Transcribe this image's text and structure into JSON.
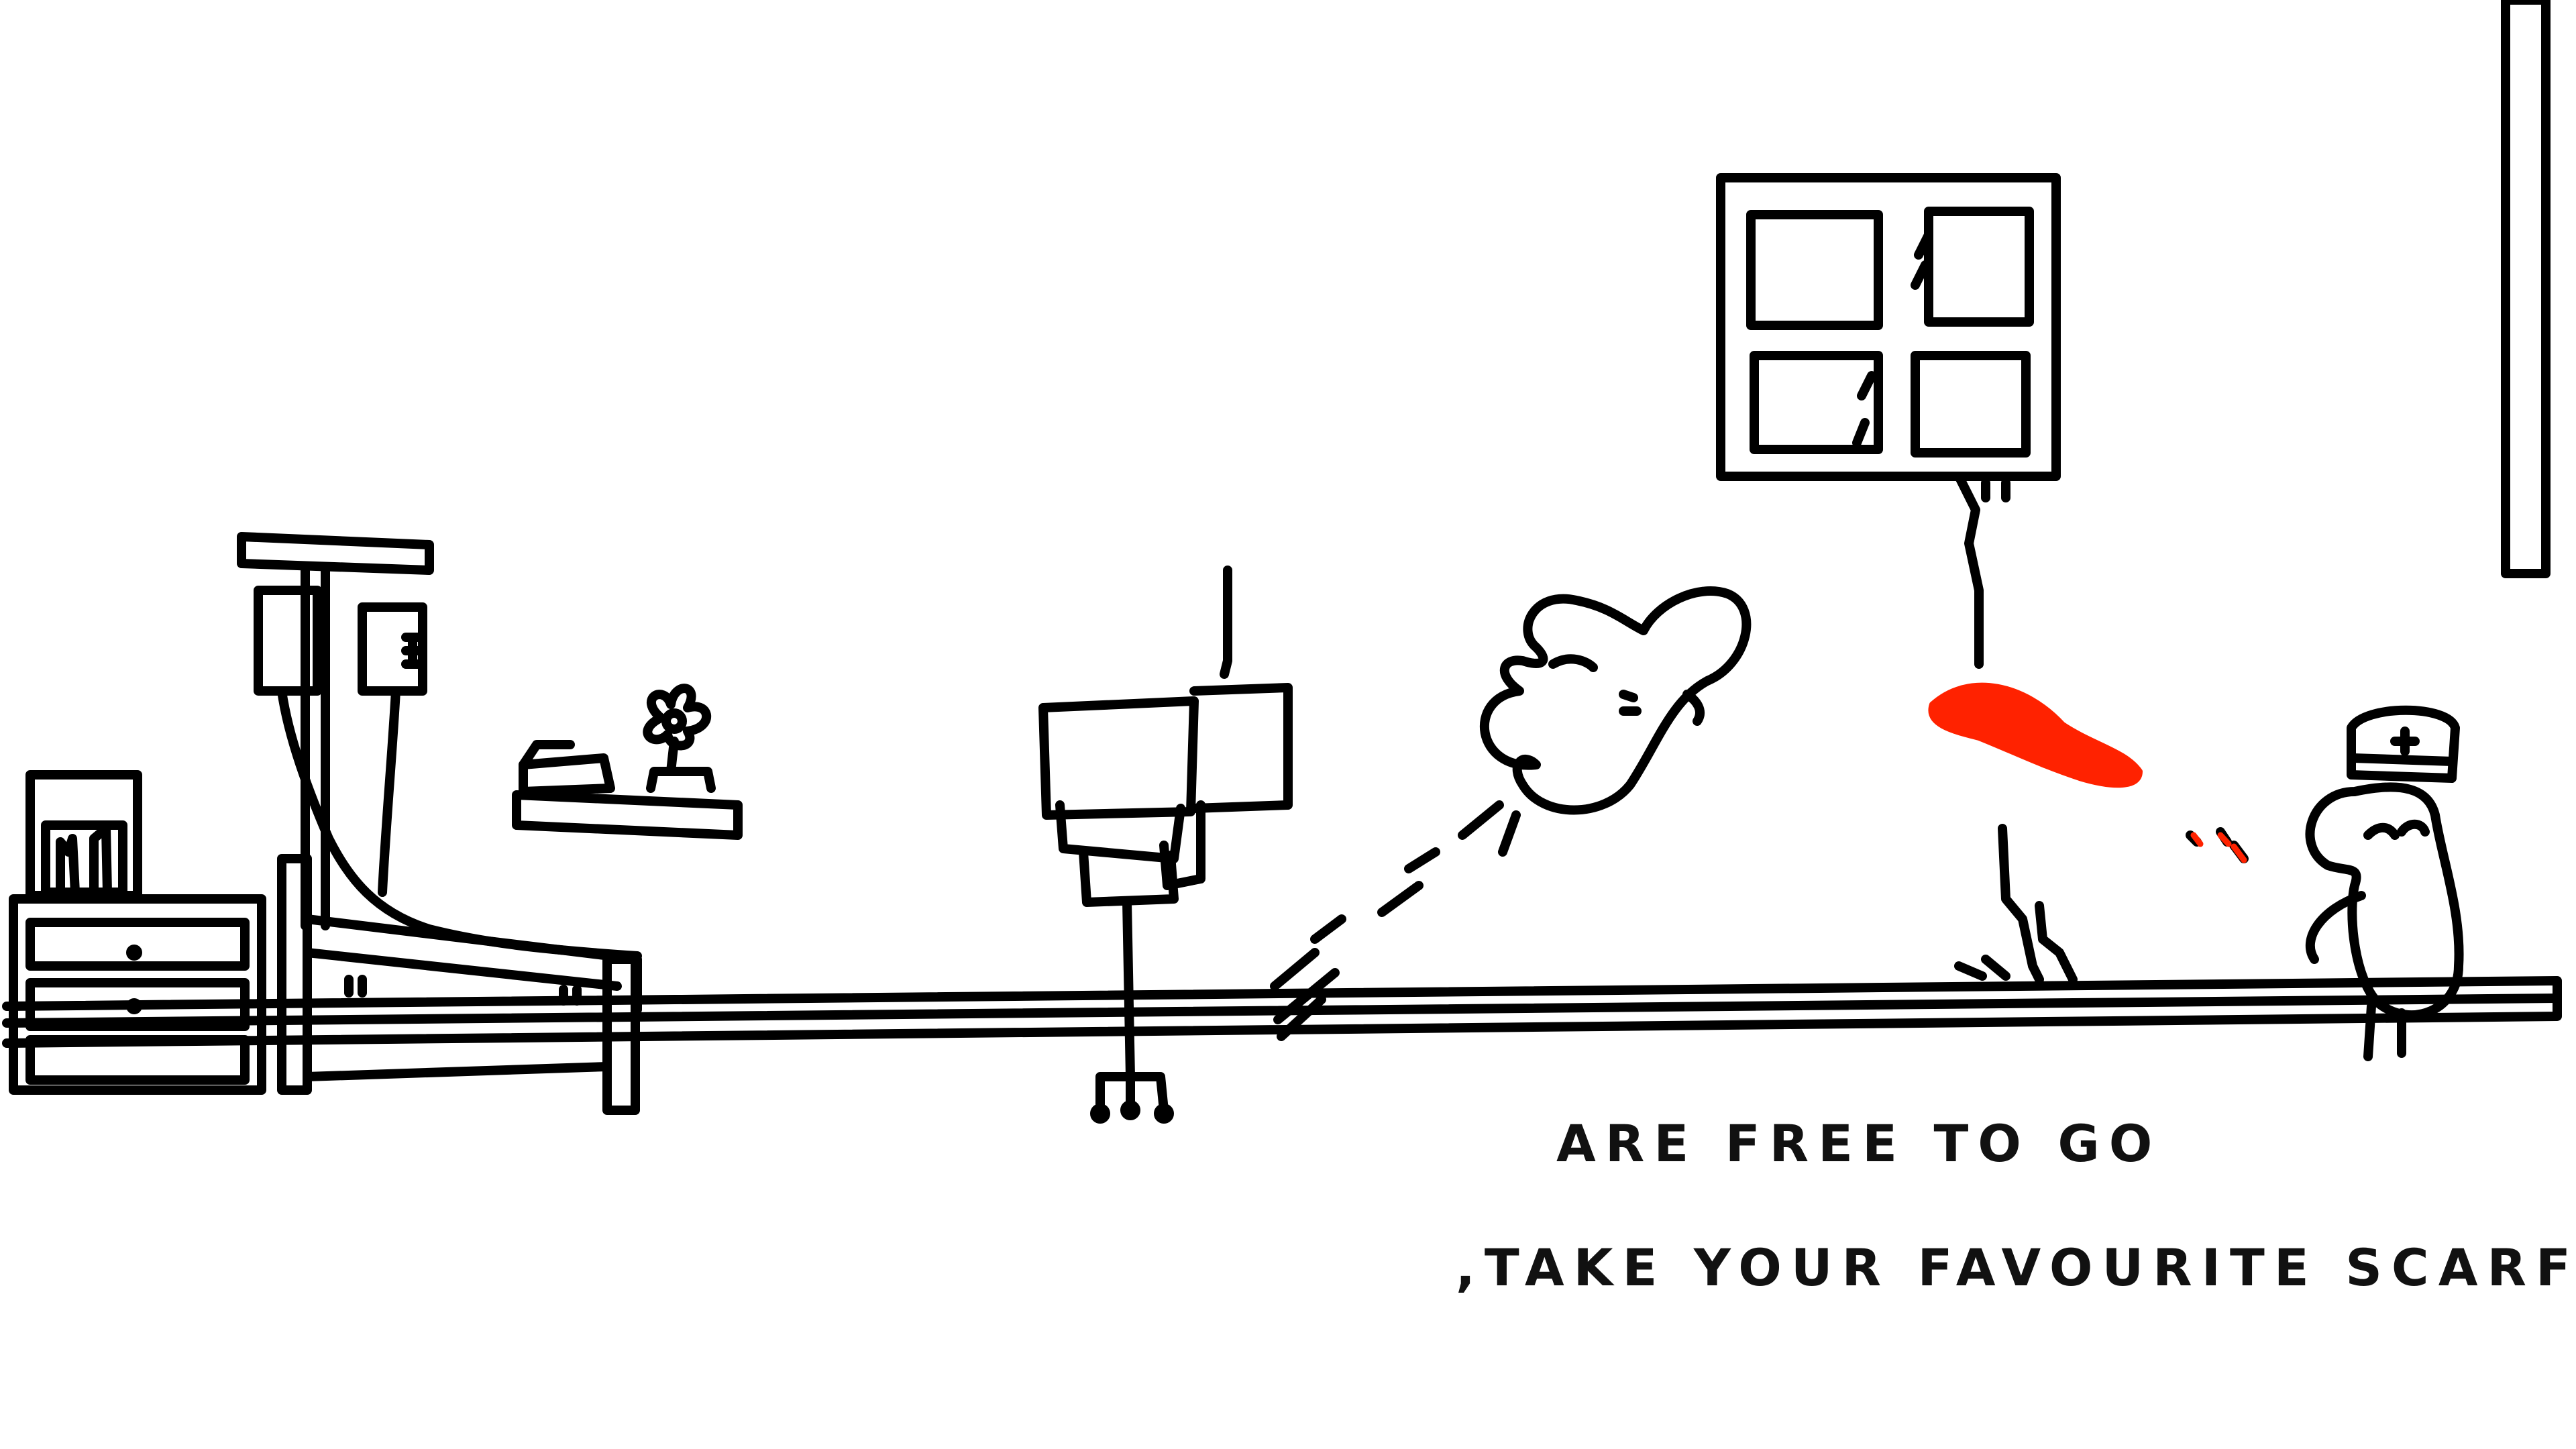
{
  "colors": {
    "ink": "#000000",
    "background": "#ffffff",
    "scarf": "#ff2200"
  },
  "dialog": {
    "line1": "ARE FREE TO GO",
    "line2": ",TAKE YOUR FAVOURITE SCARF"
  }
}
